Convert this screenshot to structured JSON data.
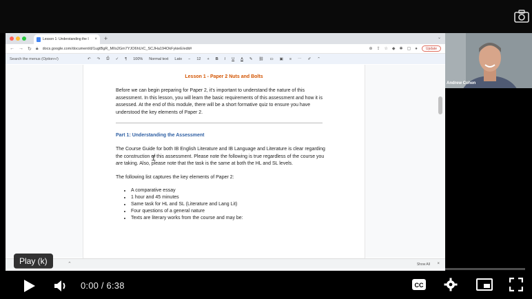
{
  "browser": {
    "tab_title": "Lesson 1: Understanding the I",
    "tab_close": "×",
    "new_tab": "+",
    "url": "docs.google.com/document/d/1ugtBgR_MIIs2Gm7YJO6hUrC_SCJHa194OkFykieE/edit#",
    "update_label": "Update"
  },
  "docs_toolbar": {
    "menu_search_placeholder": "Search the menus (Option+/)",
    "zoom": "100%",
    "style": "Normal text",
    "font": "Lato",
    "font_size": "12",
    "minus": "−",
    "plus": "+",
    "bold": "B",
    "italic": "I",
    "underline": "U",
    "text_color": "A"
  },
  "document": {
    "title": "Lesson 1 - Paper 2 Nuts and Bolts",
    "intro": "Before we can begin preparing for Paper 2, it's important to understand the nature of this assessment.  In this lesson, you will learn the basic requirements of this assessment and how it is assessed.  At the end of this module, there will be a short formative quiz to ensure you have understood the key elements of Paper 2.",
    "part_heading": "Part 1: Understanding the Assessment",
    "course_guide": "The Course Guide for both IB English Literature and IB Language and Literature is clear regarding the construction of this assessment.  Please note the following is true regardless of the course you are taking.  Also, please note that the task is the same at both the HL and SL levels.",
    "list_intro": "The following list captures the key elements of Paper 2:",
    "bullets": [
      "A comparative essay",
      "1 hour and 45 minutes",
      "Same task for HL and SL (Literature and Lang Lit)",
      "Four questions of a general nature",
      "Texts are literary works from the course and may be:"
    ]
  },
  "bottom_bar": {
    "show_all": "Show All",
    "close": "×"
  },
  "webcam": {
    "name": "Andrew Cohen"
  },
  "player": {
    "tooltip": "Play (k)",
    "current_time": "0:00",
    "duration": "6:38",
    "time_display": "0:00 / 6:38",
    "progress": 0.0,
    "cc_label": "CC",
    "progress_color": "#ff0000"
  }
}
